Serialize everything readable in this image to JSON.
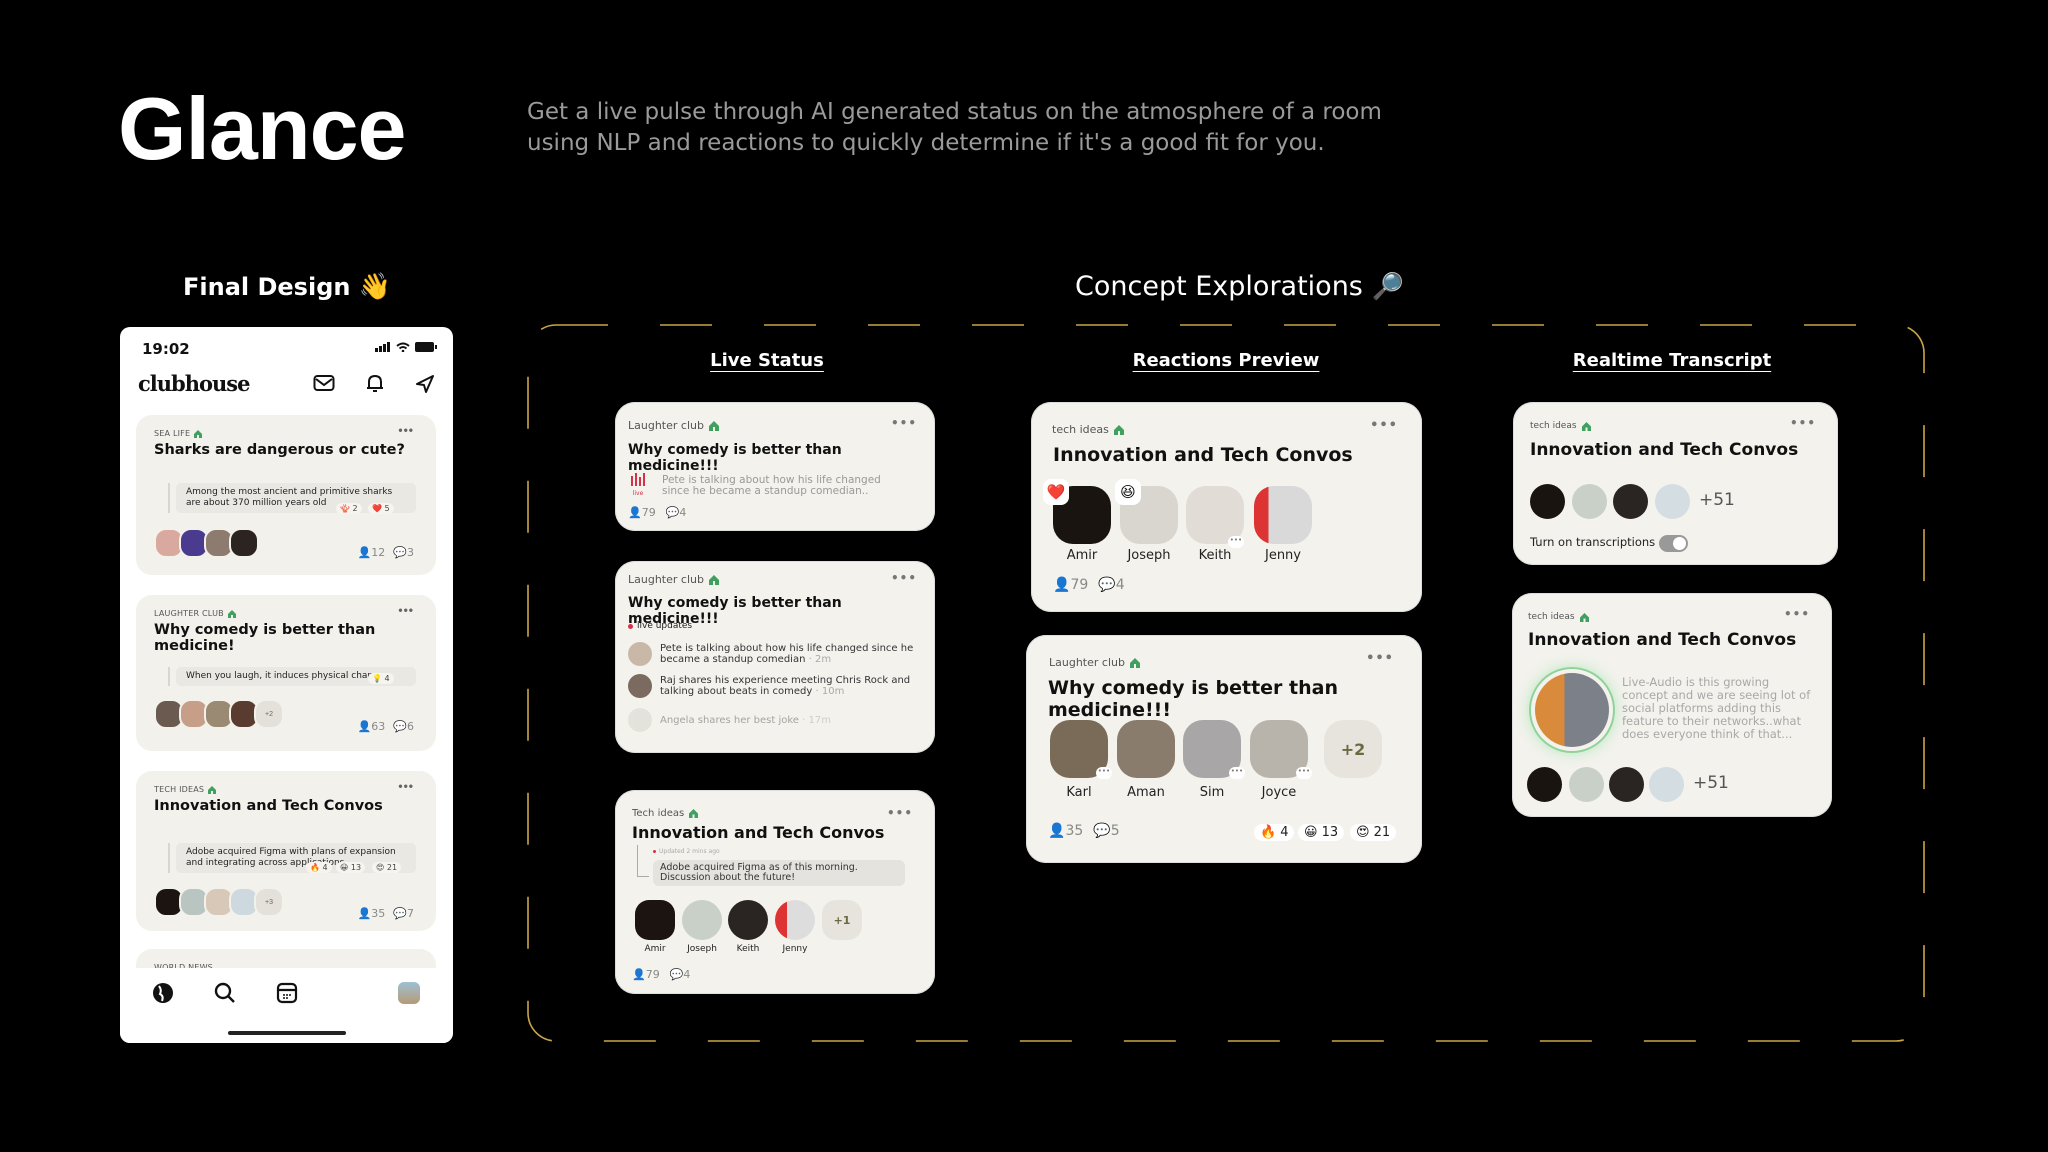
{
  "header": {
    "title": "Glance",
    "description": "Get a live pulse through AI generated status on the atmosphere of a room using NLP and reactions to quickly determine if it's a good fit for you."
  },
  "sections": {
    "final_design": {
      "label": "Final Design",
      "emoji": "👋"
    },
    "concept_explorations": {
      "label": "Concept Explorations",
      "emoji": "🔎"
    }
  },
  "colors": {
    "accent_border": "#c9a646",
    "card_bg": "#f3f2ed",
    "live_red": "#d6304a",
    "house_green": "#3fa060",
    "speaker_ring": "#8fd39a"
  },
  "phone": {
    "time": "19:02",
    "brand": "clubhouse",
    "cards": [
      {
        "club": "SEA LIFE",
        "title": "Sharks are dangerous or cute?",
        "quote": "Among the most ancient and primitive sharks are about 370 million years old",
        "reactions": [
          {
            "emoji": "🪸",
            "count": "2"
          },
          {
            "emoji": "❤️",
            "count": "5"
          }
        ],
        "listeners": "12",
        "comments": "3",
        "extra": ""
      },
      {
        "club": "LAUGHTER CLUB",
        "title": "Why comedy is better than medicine!",
        "quote": "When you laugh, it induces physical changes",
        "reactions": [
          {
            "emoji": "💡",
            "count": "4"
          }
        ],
        "listeners": "63",
        "comments": "6",
        "extra": "+2"
      },
      {
        "club": "TECH IDEAS",
        "title": "Innovation and Tech Convos",
        "quote": "Adobe acquired Figma with plans of expansion and integrating across applications",
        "reactions": [
          {
            "emoji": "🔥",
            "count": "4"
          },
          {
            "emoji": "😀",
            "count": "13"
          },
          {
            "emoji": "😍",
            "count": "21"
          }
        ],
        "listeners": "35",
        "comments": "7",
        "extra": "+3"
      },
      {
        "club": "WORLD NEWS"
      }
    ],
    "nav": [
      "explore",
      "search",
      "calendar",
      "profile"
    ]
  },
  "columns": {
    "live_status": {
      "heading": "Live Status",
      "card1": {
        "club": "Laughter club",
        "title": "Why comedy is better than medicine!!!",
        "live_label": "live",
        "status": "Pete is talking about how his life changed since he became a standup comedian..",
        "listeners": "79",
        "comments": "4"
      },
      "card2": {
        "club": "Laughter club",
        "title": "Why comedy is better than medicine!!!",
        "live_updates_label": "live updates",
        "updates": [
          {
            "text": "Pete is talking about how his life changed since he became a standup comedian",
            "time": "· 2m"
          },
          {
            "text": "Raj shares his experience meeting Chris Rock and talking about beats in comedy",
            "time": "· 10m"
          },
          {
            "text": "Angela shares her best joke",
            "time": "· 17m"
          }
        ]
      },
      "card3": {
        "club": "Tech ideas",
        "title": "Innovation and Tech Convos",
        "updated": "Updated 2 mins ago",
        "status": "Adobe acquired Figma as of this morning. Discussion about the future!",
        "speakers": [
          "Amir",
          "Joseph",
          "Keith",
          "Jenny"
        ],
        "extra": "+1",
        "listeners": "79",
        "comments": "4"
      }
    },
    "reactions_preview": {
      "heading": "Reactions Preview",
      "card1": {
        "club": "tech ideas",
        "title": "Innovation and Tech Convos",
        "speakers": [
          "Amir",
          "Joseph",
          "Keith",
          "Jenny"
        ],
        "reactions": [
          {
            "speaker": "Amir",
            "emoji": "❤️"
          },
          {
            "speaker": "Joseph",
            "emoji": "😆"
          }
        ],
        "listeners": "79",
        "comments": "4"
      },
      "card2": {
        "club": "Laughter club",
        "title": "Why comedy is better than medicine!!!",
        "speakers": [
          "Karl",
          "Aman",
          "Sim",
          "Joyce"
        ],
        "extra": "+2",
        "listeners": "35",
        "comments": "5",
        "reactions": [
          {
            "emoji": "🔥",
            "count": "4"
          },
          {
            "emoji": "😀",
            "count": "13"
          },
          {
            "emoji": "😍",
            "count": "21"
          }
        ]
      }
    },
    "realtime_transcript": {
      "heading": "Realtime Transcript",
      "card1": {
        "club": "tech ideas",
        "title": "Innovation and Tech Convos",
        "extra": "+51",
        "toggle_label": "Turn on transcriptions",
        "toggle_on": false
      },
      "card2": {
        "club": "tech ideas",
        "title": "Innovation and Tech Convos",
        "transcript": "Live-Audio is this growing concept and we are seeing lot of social platforms adding this feature to their networks..what does everyone think of that...",
        "extra": "+51"
      }
    }
  }
}
